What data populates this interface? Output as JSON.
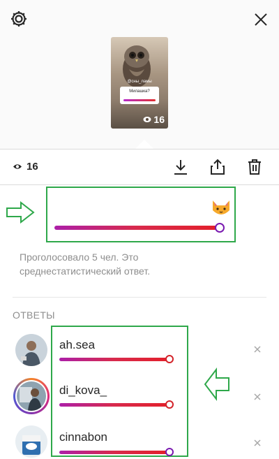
{
  "header": {
    "settings_icon": "gear-icon",
    "close_icon": "close-icon"
  },
  "story_preview": {
    "handle": "@сны_ламы",
    "question": "Милашка?",
    "view_count": "16"
  },
  "toolbar": {
    "view_count": "16",
    "download_icon": "download-icon",
    "share_icon": "share-icon",
    "delete_icon": "trash-icon"
  },
  "poll": {
    "emoji": "cat-face-icon",
    "average_fraction": 1.0,
    "summary": "Проголосовало 5 чел. Это среднестатистический ответ."
  },
  "answers": {
    "heading": "ОТВЕТЫ",
    "items": [
      {
        "username": "ah.sea",
        "value_fraction": 1.0,
        "remove_icon": "close-icon"
      },
      {
        "username": "di_kova_",
        "value_fraction": 1.0,
        "remove_icon": "close-icon"
      },
      {
        "username": "cinnabon",
        "value_fraction": 1.0,
        "remove_icon": "close-icon"
      }
    ]
  },
  "colors": {
    "annotation_green": "#2ea84a",
    "slider_start": "#ac1fa8",
    "slider_end": "#e3202b"
  }
}
